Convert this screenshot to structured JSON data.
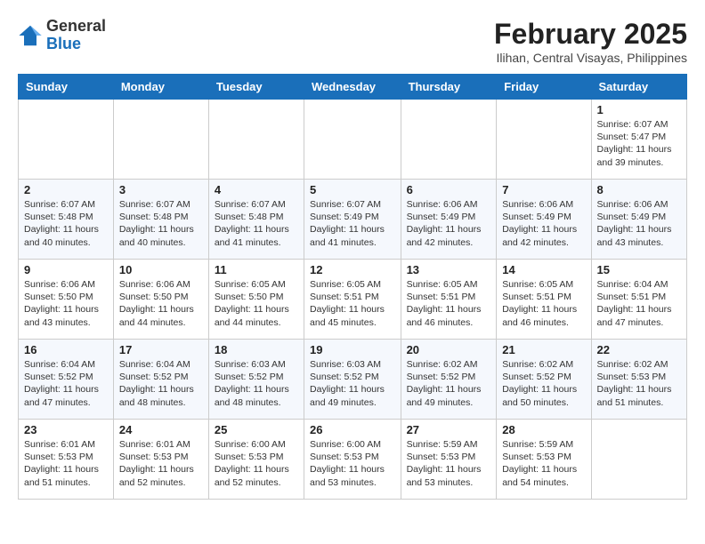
{
  "header": {
    "logo": {
      "general": "General",
      "blue": "Blue"
    },
    "month_year": "February 2025",
    "location": "Ilihan, Central Visayas, Philippines"
  },
  "weekdays": [
    "Sunday",
    "Monday",
    "Tuesday",
    "Wednesday",
    "Thursday",
    "Friday",
    "Saturday"
  ],
  "weeks": [
    [
      {
        "day": "",
        "info": ""
      },
      {
        "day": "",
        "info": ""
      },
      {
        "day": "",
        "info": ""
      },
      {
        "day": "",
        "info": ""
      },
      {
        "day": "",
        "info": ""
      },
      {
        "day": "",
        "info": ""
      },
      {
        "day": "1",
        "info": "Sunrise: 6:07 AM\nSunset: 5:47 PM\nDaylight: 11 hours and 39 minutes."
      }
    ],
    [
      {
        "day": "2",
        "info": "Sunrise: 6:07 AM\nSunset: 5:48 PM\nDaylight: 11 hours and 40 minutes."
      },
      {
        "day": "3",
        "info": "Sunrise: 6:07 AM\nSunset: 5:48 PM\nDaylight: 11 hours and 40 minutes."
      },
      {
        "day": "4",
        "info": "Sunrise: 6:07 AM\nSunset: 5:48 PM\nDaylight: 11 hours and 41 minutes."
      },
      {
        "day": "5",
        "info": "Sunrise: 6:07 AM\nSunset: 5:49 PM\nDaylight: 11 hours and 41 minutes."
      },
      {
        "day": "6",
        "info": "Sunrise: 6:06 AM\nSunset: 5:49 PM\nDaylight: 11 hours and 42 minutes."
      },
      {
        "day": "7",
        "info": "Sunrise: 6:06 AM\nSunset: 5:49 PM\nDaylight: 11 hours and 42 minutes."
      },
      {
        "day": "8",
        "info": "Sunrise: 6:06 AM\nSunset: 5:49 PM\nDaylight: 11 hours and 43 minutes."
      }
    ],
    [
      {
        "day": "9",
        "info": "Sunrise: 6:06 AM\nSunset: 5:50 PM\nDaylight: 11 hours and 43 minutes."
      },
      {
        "day": "10",
        "info": "Sunrise: 6:06 AM\nSunset: 5:50 PM\nDaylight: 11 hours and 44 minutes."
      },
      {
        "day": "11",
        "info": "Sunrise: 6:05 AM\nSunset: 5:50 PM\nDaylight: 11 hours and 44 minutes."
      },
      {
        "day": "12",
        "info": "Sunrise: 6:05 AM\nSunset: 5:51 PM\nDaylight: 11 hours and 45 minutes."
      },
      {
        "day": "13",
        "info": "Sunrise: 6:05 AM\nSunset: 5:51 PM\nDaylight: 11 hours and 46 minutes."
      },
      {
        "day": "14",
        "info": "Sunrise: 6:05 AM\nSunset: 5:51 PM\nDaylight: 11 hours and 46 minutes."
      },
      {
        "day": "15",
        "info": "Sunrise: 6:04 AM\nSunset: 5:51 PM\nDaylight: 11 hours and 47 minutes."
      }
    ],
    [
      {
        "day": "16",
        "info": "Sunrise: 6:04 AM\nSunset: 5:52 PM\nDaylight: 11 hours and 47 minutes."
      },
      {
        "day": "17",
        "info": "Sunrise: 6:04 AM\nSunset: 5:52 PM\nDaylight: 11 hours and 48 minutes."
      },
      {
        "day": "18",
        "info": "Sunrise: 6:03 AM\nSunset: 5:52 PM\nDaylight: 11 hours and 48 minutes."
      },
      {
        "day": "19",
        "info": "Sunrise: 6:03 AM\nSunset: 5:52 PM\nDaylight: 11 hours and 49 minutes."
      },
      {
        "day": "20",
        "info": "Sunrise: 6:02 AM\nSunset: 5:52 PM\nDaylight: 11 hours and 49 minutes."
      },
      {
        "day": "21",
        "info": "Sunrise: 6:02 AM\nSunset: 5:52 PM\nDaylight: 11 hours and 50 minutes."
      },
      {
        "day": "22",
        "info": "Sunrise: 6:02 AM\nSunset: 5:53 PM\nDaylight: 11 hours and 51 minutes."
      }
    ],
    [
      {
        "day": "23",
        "info": "Sunrise: 6:01 AM\nSunset: 5:53 PM\nDaylight: 11 hours and 51 minutes."
      },
      {
        "day": "24",
        "info": "Sunrise: 6:01 AM\nSunset: 5:53 PM\nDaylight: 11 hours and 52 minutes."
      },
      {
        "day": "25",
        "info": "Sunrise: 6:00 AM\nSunset: 5:53 PM\nDaylight: 11 hours and 52 minutes."
      },
      {
        "day": "26",
        "info": "Sunrise: 6:00 AM\nSunset: 5:53 PM\nDaylight: 11 hours and 53 minutes."
      },
      {
        "day": "27",
        "info": "Sunrise: 5:59 AM\nSunset: 5:53 PM\nDaylight: 11 hours and 53 minutes."
      },
      {
        "day": "28",
        "info": "Sunrise: 5:59 AM\nSunset: 5:53 PM\nDaylight: 11 hours and 54 minutes."
      },
      {
        "day": "",
        "info": ""
      }
    ]
  ]
}
